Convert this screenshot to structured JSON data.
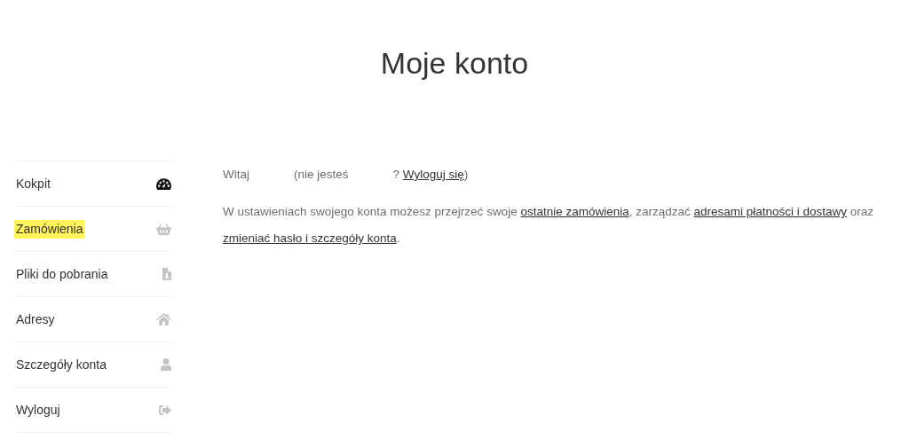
{
  "page_title": "Moje konto",
  "menu": [
    {
      "label": "Kokpit",
      "selected": true,
      "highlighted": false
    },
    {
      "label": "Zamówienia",
      "selected": false,
      "highlighted": true
    },
    {
      "label": "Pliki do pobrania",
      "selected": false,
      "highlighted": false
    },
    {
      "label": "Adresy",
      "selected": false,
      "highlighted": false
    },
    {
      "label": "Szczegóły konta",
      "selected": false,
      "highlighted": false
    },
    {
      "label": "Wyloguj",
      "selected": false,
      "highlighted": false
    }
  ],
  "greeting": [
    {
      "kind": "text",
      "text": "Witaj"
    },
    {
      "kind": "gap"
    },
    {
      "kind": "text",
      "text": "(nie jesteś"
    },
    {
      "kind": "gap"
    },
    {
      "kind": "text",
      "text": "? "
    },
    {
      "kind": "link",
      "text": "Wyloguj się"
    },
    {
      "kind": "text",
      "text": ")"
    }
  ],
  "intro": [
    {
      "kind": "text",
      "text": "W ustawieniach swojego konta możesz przejrzeć swoje "
    },
    {
      "kind": "link",
      "text": "ostatnie zamówienia"
    },
    {
      "kind": "text",
      "text": ", zarządzać "
    },
    {
      "kind": "link",
      "text": "adresami płatności i dostawy"
    },
    {
      "kind": "text",
      "text": " oraz "
    },
    {
      "kind": "link",
      "text": "zmieniać hasło i szczegóły konta"
    },
    {
      "kind": "text",
      "text": "."
    }
  ]
}
